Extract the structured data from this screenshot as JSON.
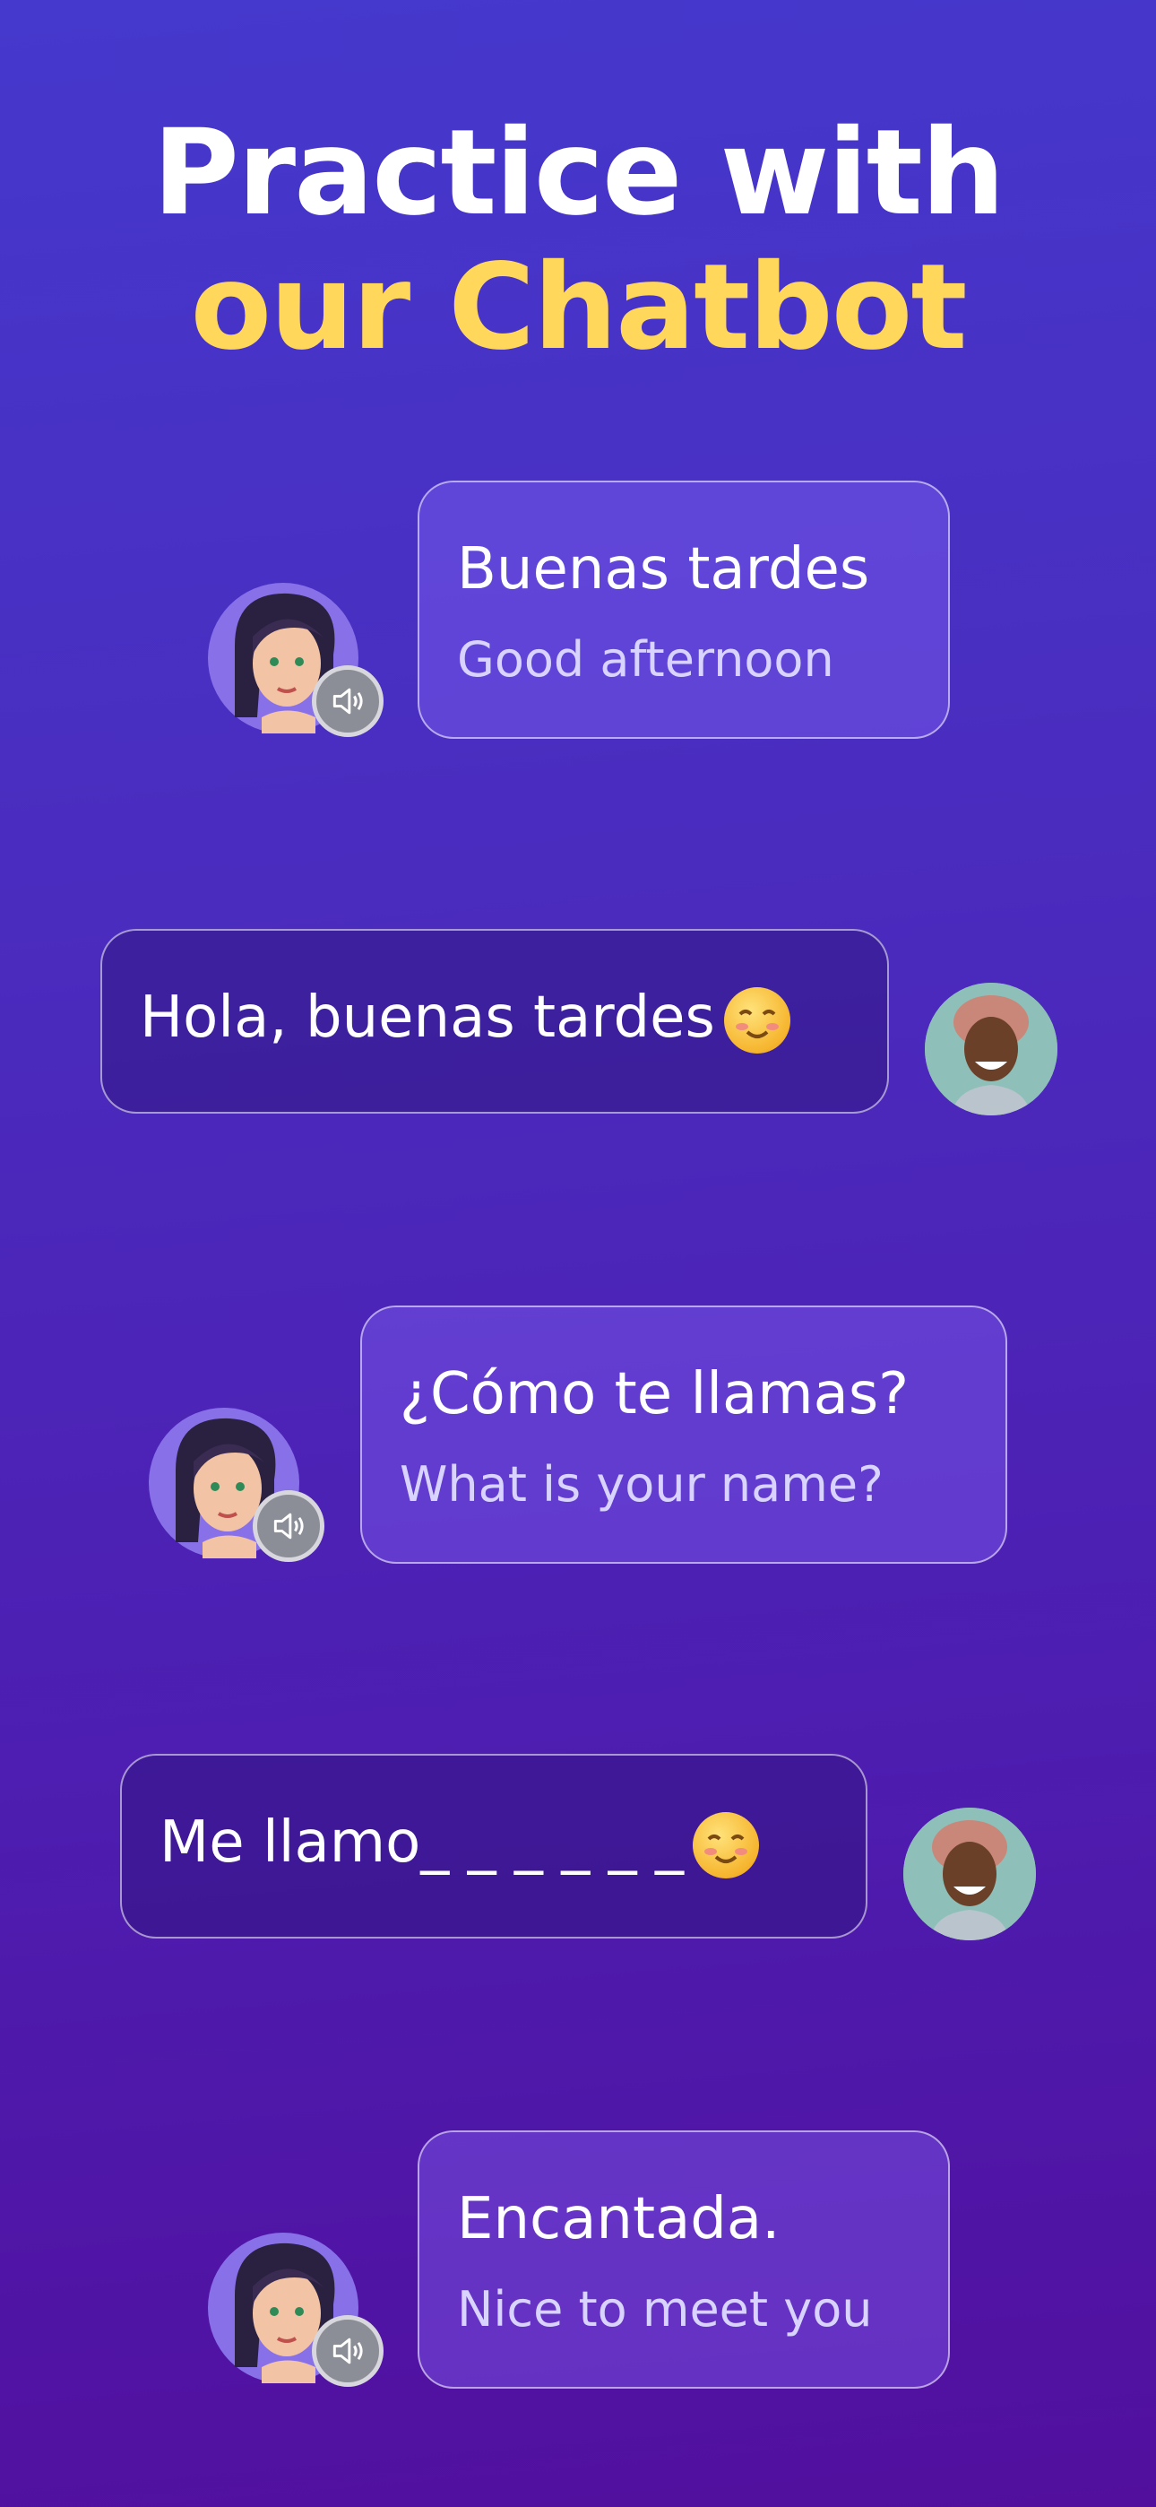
{
  "header": {
    "line1": "Practice with",
    "line2": "our Chatbot"
  },
  "colors": {
    "accent": "#ffd75a",
    "text": "#ffffff",
    "background_top": "#4538cc",
    "background_bottom": "#520f9e"
  },
  "messages": [
    {
      "sender": "bot",
      "text": "Buenas tardes",
      "translation": "Good afternoon",
      "icon": "speaker-icon"
    },
    {
      "sender": "user",
      "text": "Hola, buenas tardes",
      "emoji": "smiling-face-emoji"
    },
    {
      "sender": "bot",
      "text": "¿Cómo te llamas?",
      "translation": "What is your name?",
      "icon": "speaker-icon"
    },
    {
      "sender": "user",
      "text": "Me llamo_ _ _ _ _ _",
      "emoji": "smiling-face-emoji"
    },
    {
      "sender": "bot",
      "text": "Encantada.",
      "translation": "Nice to meet you",
      "icon": "speaker-icon"
    }
  ]
}
